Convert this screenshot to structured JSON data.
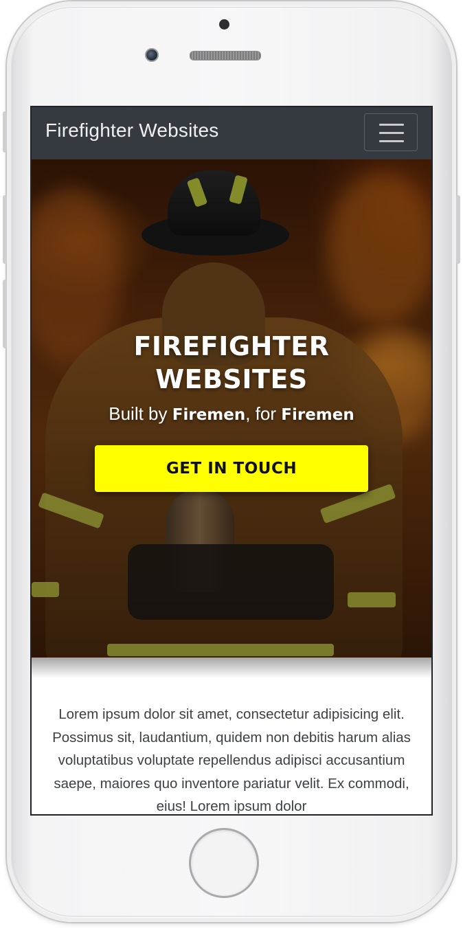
{
  "navbar": {
    "brand": "Firefighter Websites",
    "toggler_icon": "hamburger-menu-icon"
  },
  "hero": {
    "title_line1": "FIREFIGHTER",
    "title_line2": "WEBSITES",
    "subtitle": {
      "prefix": "Built by ",
      "bold1": "Firemen",
      "middle": ", for ",
      "bold2": "Firemen"
    },
    "cta_label": "GET IN TOUCH",
    "cta_color": "#ffff00",
    "background": "firefighter-in-flames-photo"
  },
  "content": {
    "paragraph": "Lorem ipsum dolor sit amet, consectetur adipisicing elit. Possimus sit, laudantium, quidem non debitis harum alias voluptatibus voluptate repellendus adipisci accusantium saepe, maiores quo inventore pariatur velit. Ex commodi, eius! Lorem ipsum dolor"
  },
  "colors": {
    "navbar_bg": "#353a41",
    "brand_text": "#f0f0f0",
    "body_text": "#3c3f44"
  }
}
